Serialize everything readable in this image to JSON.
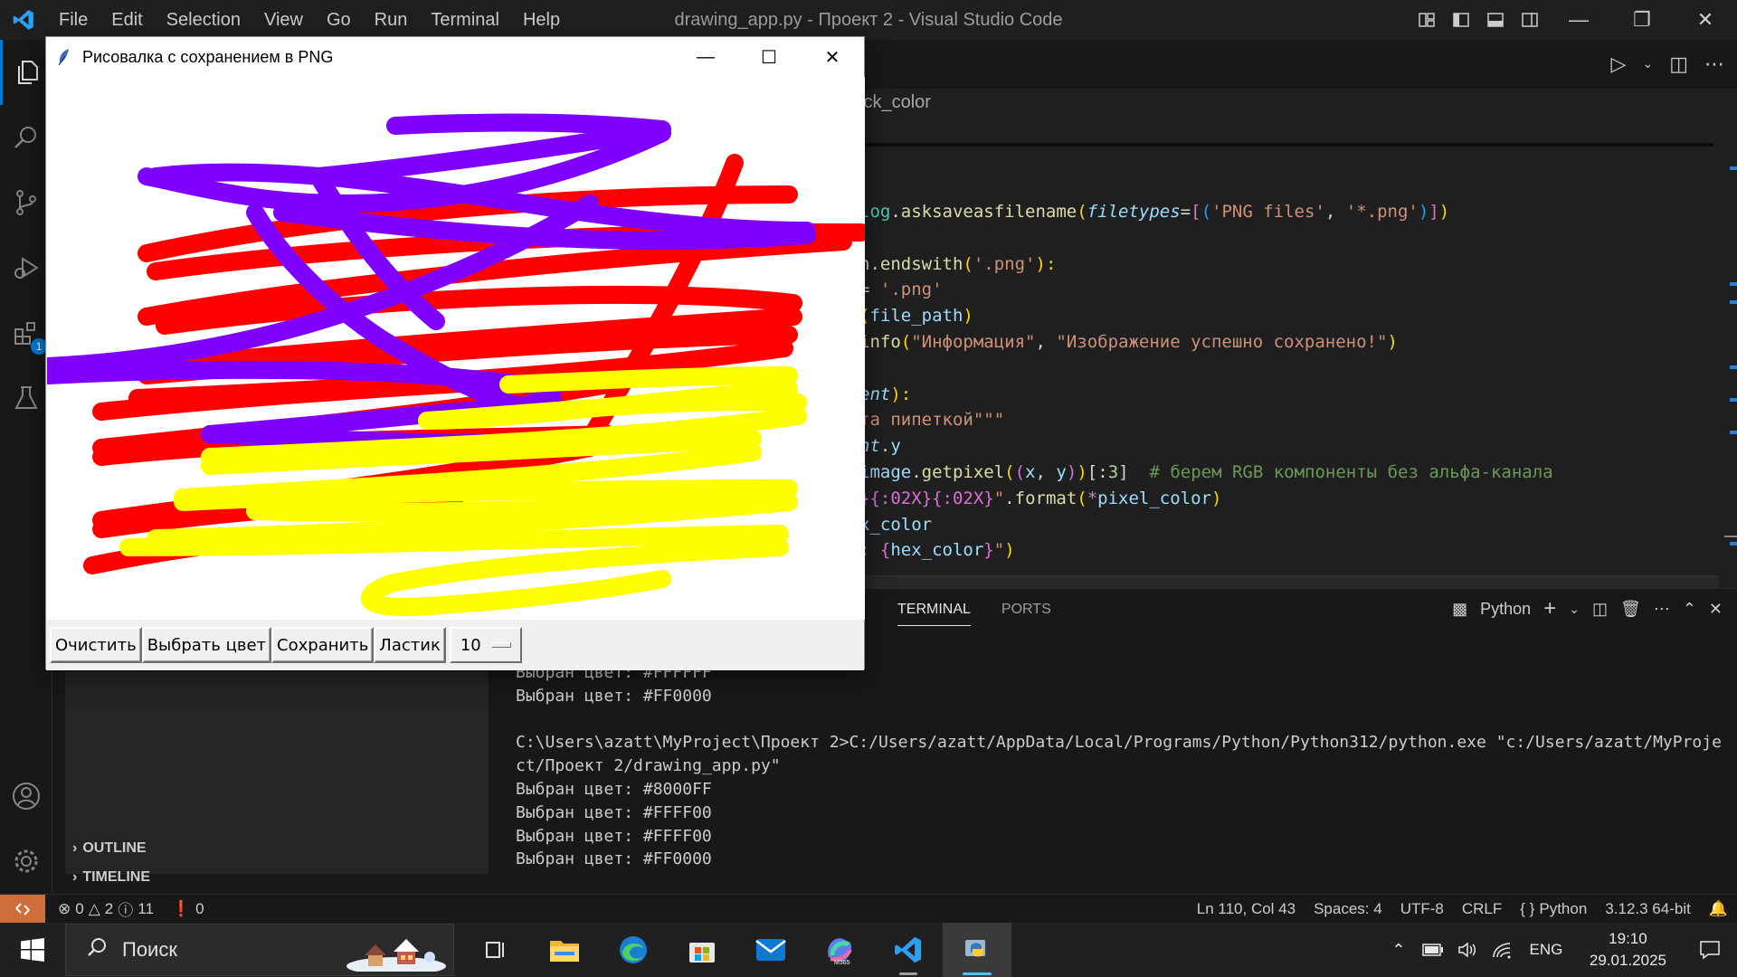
{
  "vscode": {
    "menu": [
      "File",
      "Edit",
      "Selection",
      "View",
      "Go",
      "Run",
      "Terminal",
      "Help"
    ],
    "window_title": "drawing_app.py - Проект 2 - Visual Studio Code",
    "breadcrumb": "ick_color",
    "code_lines": [
      {
        "parts": [
          [
            "kw-cls",
            "log"
          ],
          [
            "kw-op",
            "."
          ],
          [
            "kw-fn",
            "asksaveasfilename"
          ],
          [
            "kw-br1",
            "("
          ],
          [
            "kw-param",
            "filetypes"
          ],
          [
            "kw-op",
            "="
          ],
          [
            "kw-br2",
            "["
          ],
          [
            "kw-br3",
            "("
          ],
          [
            "kw-str",
            "'PNG files'"
          ],
          [
            "kw-op",
            ", "
          ],
          [
            "kw-str",
            "'*.png'"
          ],
          [
            "kw-br3",
            ")"
          ],
          [
            "kw-br2",
            "]"
          ],
          [
            "kw-br1",
            ")"
          ]
        ]
      },
      {
        "parts": []
      },
      {
        "parts": [
          [
            "kw-op",
            "n."
          ],
          [
            "kw-fn",
            "endswith"
          ],
          [
            "kw-br1",
            "("
          ],
          [
            "kw-str",
            "'.png'"
          ],
          [
            "kw-br1",
            "):"
          ]
        ]
      },
      {
        "parts": [
          [
            "kw-op",
            "= "
          ],
          [
            "kw-str",
            "'.png'"
          ]
        ]
      },
      {
        "parts": [
          [
            "kw-br1",
            "("
          ],
          [
            "kw-var",
            "file_path"
          ],
          [
            "kw-br1",
            ")"
          ]
        ]
      },
      {
        "parts": [
          [
            "kw-fn",
            "info"
          ],
          [
            "kw-br1",
            "("
          ],
          [
            "kw-str",
            "\"Информация\""
          ],
          [
            "kw-op",
            ", "
          ],
          [
            "kw-str",
            "\"Изображение успешно сохранено!\""
          ],
          [
            "kw-br1",
            ")"
          ]
        ]
      },
      {
        "parts": []
      },
      {
        "parts": [
          [
            "kw-param",
            "ent"
          ],
          [
            "kw-br1",
            "):"
          ]
        ]
      },
      {
        "parts": [
          [
            "kw-str",
            "та пипеткой\"\"\""
          ]
        ]
      },
      {
        "parts": [
          [
            "kw-param",
            "nt"
          ],
          [
            "kw-op",
            "."
          ],
          [
            "kw-var",
            "y"
          ]
        ]
      },
      {
        "parts": [
          [
            "kw-var",
            "image"
          ],
          [
            "kw-op",
            "."
          ],
          [
            "kw-fn",
            "getpixel"
          ],
          [
            "kw-br1",
            "("
          ],
          [
            "kw-br2",
            "("
          ],
          [
            "kw-var",
            "x"
          ],
          [
            "kw-op",
            ", "
          ],
          [
            "kw-var",
            "y"
          ],
          [
            "kw-br2",
            ")"
          ],
          [
            "kw-br1",
            ")"
          ],
          [
            "kw-op",
            "["
          ],
          [
            "kw-op",
            ":"
          ],
          [
            "kw-num",
            "3"
          ],
          [
            "kw-op",
            "]  "
          ],
          [
            "kw-com",
            "# берем RGB компоненты без альфа-канала"
          ]
        ]
      },
      {
        "parts": [
          [
            "kw-br2",
            "}{:02X}{:02X}"
          ],
          [
            "kw-str",
            "\""
          ],
          [
            "kw-op",
            "."
          ],
          [
            "kw-fn",
            "format"
          ],
          [
            "kw-br1",
            "("
          ],
          [
            "kw-kw",
            "*"
          ],
          [
            "kw-var",
            "pixel_color"
          ],
          [
            "kw-br1",
            ")"
          ]
        ]
      },
      {
        "parts": [
          [
            "kw-var",
            "x_color"
          ]
        ]
      },
      {
        "parts": [
          [
            "kw-str",
            ": "
          ],
          [
            "kw-br2",
            "{"
          ],
          [
            "kw-var",
            "hex_color"
          ],
          [
            "kw-br2",
            "}"
          ],
          [
            "kw-str",
            "\""
          ],
          [
            "kw-br1",
            ")"
          ]
        ]
      }
    ],
    "sidebar_sections": [
      "OUTLINE",
      "TIMELINE"
    ],
    "extensions_badge": "1",
    "panel_tabs": [
      "TERMINAL",
      "PORTS"
    ],
    "terminal_shell": "Python",
    "terminal_lines": [
      "Выбран цвет: #FFFFFF",
      "Выбран цвет: #FF0000",
      "",
      "C:\\Users\\azatt\\MyProject\\Проект 2>C:/Users/azatt/AppData/Local/Programs/Python/Python312/python.exe \"c:/Users/azatt/MyProject/Проект 2/drawing_app.py\"",
      "Выбран цвет: #8000FF",
      "Выбран цвет: #FFFF00",
      "Выбран цвет: #FFFF00",
      "Выбран цвет: #FF0000"
    ],
    "status": {
      "errors": "0",
      "warnings": "2",
      "infos": "11",
      "ports": "0",
      "position": "Ln 110, Col 43",
      "spaces": "Spaces: 4",
      "encoding": "UTF-8",
      "eol": "CRLF",
      "language": "Python",
      "interpreter": "3.12.3 64-bit"
    }
  },
  "tk_app": {
    "title": "Рисовалка с сохранением в PNG",
    "buttons": [
      "Очистить",
      "Выбрать цвет",
      "Сохранить",
      "Ластик"
    ],
    "brush_size": "10",
    "stroke_colors": {
      "purple": "#8000FF",
      "red": "#FF0000",
      "yellow": "#FFFF00"
    }
  },
  "taskbar": {
    "search_placeholder": "Поиск",
    "language": "ENG",
    "time": "19:10",
    "date": "29.01.2025"
  }
}
